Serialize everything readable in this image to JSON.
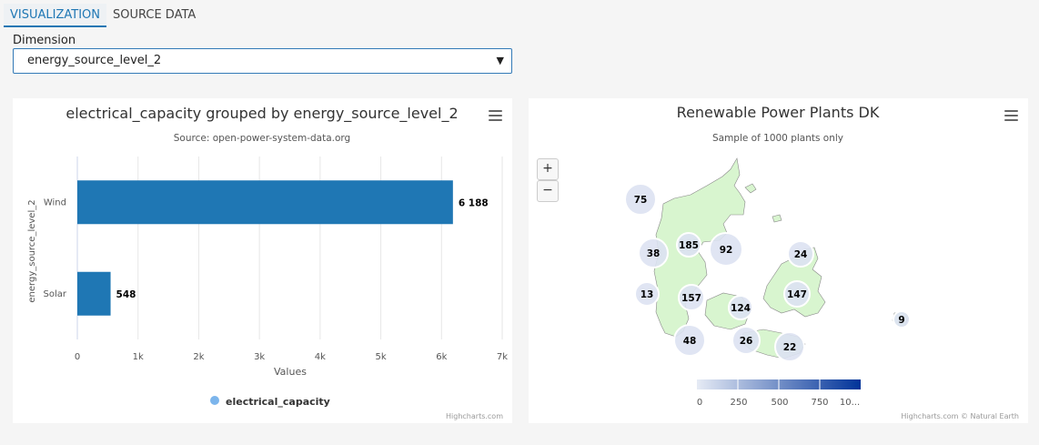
{
  "tabs": [
    {
      "label": "VISUALIZATION",
      "active": true
    },
    {
      "label": "SOURCE DATA",
      "active": false
    }
  ],
  "dimension": {
    "label": "Dimension",
    "selected": "energy_source_level_2"
  },
  "bar_card": {
    "title": "electrical_capacity grouped by energy_source_level_2",
    "subtitle": "Source: open-power-system-data.org",
    "credits": "Highcharts.com"
  },
  "map_card": {
    "title": "Renewable Power Plants DK",
    "subtitle": "Sample of 1000 plants only",
    "credits": "Highcharts.com © Natural Earth",
    "zoom_in": "+",
    "zoom_out": "−"
  },
  "colors": {
    "accent": "#1f77b4",
    "bar": "#1f77b4",
    "legend_marker": "#7cb5ec",
    "land": "#d8f5cf",
    "cluster": "#dde2f2",
    "color_axis_start": "#e6ebf5",
    "color_axis_end": "#003399"
  },
  "chart_data": [
    {
      "type": "bar",
      "orientation": "horizontal",
      "title": "electrical_capacity grouped by energy_source_level_2",
      "subtitle": "Source: open-power-system-data.org",
      "categories": [
        "Wind",
        "Solar"
      ],
      "series": [
        {
          "name": "electrical_capacity",
          "values": [
            6188,
            548
          ]
        }
      ],
      "data_labels": [
        "6 188",
        "548"
      ],
      "xlabel": "Values",
      "ylabel": "energy_source_level_2",
      "xlim": [
        0,
        7000
      ],
      "ticks": [
        "0",
        "1k",
        "2k",
        "3k",
        "4k",
        "5k",
        "6k",
        "7k"
      ],
      "grid": true,
      "legend": "bottom-center"
    },
    {
      "type": "map",
      "title": "Renewable Power Plants DK",
      "subtitle": "Sample of 1000 plants only",
      "cluster_counts": [
        75,
        38,
        185,
        92,
        24,
        13,
        157,
        147,
        124,
        9,
        48,
        26,
        22
      ],
      "color_axis_labels": [
        "0",
        "250",
        "500",
        "750",
        "10..."
      ],
      "color_axis_range": [
        0,
        1000
      ]
    }
  ]
}
